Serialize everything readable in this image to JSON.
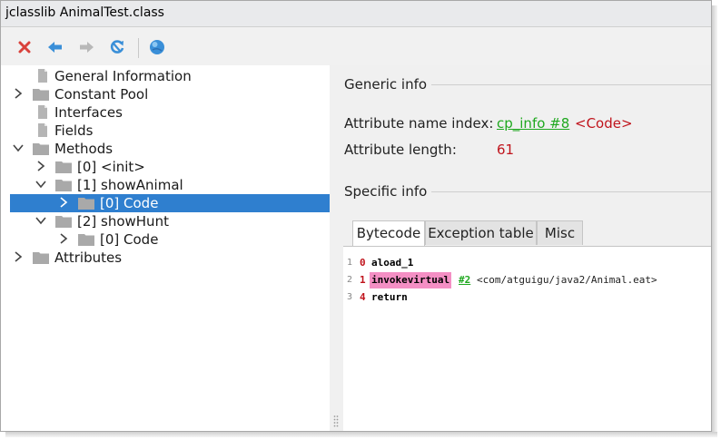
{
  "window": {
    "title": "jclasslib AnimalTest.class"
  },
  "toolbar": {
    "buttons": [
      {
        "name": "close",
        "icon": "close-x-icon",
        "color": "#d9413b"
      },
      {
        "name": "back",
        "icon": "arrow-left-icon",
        "color": "#3a8fd8"
      },
      {
        "name": "forward",
        "icon": "arrow-right-icon",
        "color": "#b8b8b8"
      },
      {
        "name": "reload",
        "icon": "reload-icon",
        "color": "#3a8fd8"
      },
      {
        "name": "web",
        "icon": "globe-icon",
        "color": "#3a8fd8"
      }
    ]
  },
  "tree": {
    "items": [
      {
        "label": "General Information",
        "depth": 0,
        "expandable": false,
        "icon": "file-icon"
      },
      {
        "label": "Constant Pool",
        "depth": 0,
        "expandable": true,
        "expanded": false,
        "icon": "folder-icon"
      },
      {
        "label": "Interfaces",
        "depth": 0,
        "expandable": false,
        "icon": "file-icon"
      },
      {
        "label": "Fields",
        "depth": 0,
        "expandable": false,
        "icon": "file-icon"
      },
      {
        "label": "Methods",
        "depth": 0,
        "expandable": true,
        "expanded": true,
        "icon": "folder-icon"
      },
      {
        "label": "[0] <init>",
        "depth": 1,
        "expandable": true,
        "expanded": false,
        "icon": "folder-icon"
      },
      {
        "label": "[1] showAnimal",
        "depth": 1,
        "expandable": true,
        "expanded": true,
        "icon": "folder-icon"
      },
      {
        "label": "[0] Code",
        "depth": 2,
        "expandable": true,
        "expanded": false,
        "icon": "folder-icon",
        "selected": true
      },
      {
        "label": "[2] showHunt",
        "depth": 1,
        "expandable": true,
        "expanded": true,
        "icon": "folder-icon"
      },
      {
        "label": "[0] Code",
        "depth": 2,
        "expandable": true,
        "expanded": false,
        "icon": "folder-icon"
      },
      {
        "label": "Attributes",
        "depth": 0,
        "expandable": true,
        "expanded": false,
        "icon": "folder-icon"
      }
    ]
  },
  "generic": {
    "title": "Generic info",
    "name_index_label": "Attribute name index:",
    "name_index_link": "cp_info #8",
    "name_index_value": "<Code>",
    "length_label": "Attribute length:",
    "length_value": "61"
  },
  "specific": {
    "title": "Specific info",
    "tabs": [
      {
        "label": "Bytecode",
        "active": true
      },
      {
        "label": "Exception table",
        "active": false
      },
      {
        "label": "Misc",
        "active": false
      }
    ]
  },
  "bytecode": [
    {
      "line": "1",
      "offset": "0",
      "opcode": "aload_1",
      "highlight": false,
      "ref": "",
      "comment": ""
    },
    {
      "line": "2",
      "offset": "1",
      "opcode": "invokevirtual",
      "highlight": true,
      "ref": "#2",
      "comment": "<com/atguigu/java2/Animal.eat>"
    },
    {
      "line": "3",
      "offset": "4",
      "opcode": "return",
      "highlight": false,
      "ref": "",
      "comment": ""
    }
  ],
  "colors": {
    "selection": "#2f7fcf",
    "link": "#1fa81f",
    "value": "#c0141c",
    "highlight": "#f48fc4"
  }
}
